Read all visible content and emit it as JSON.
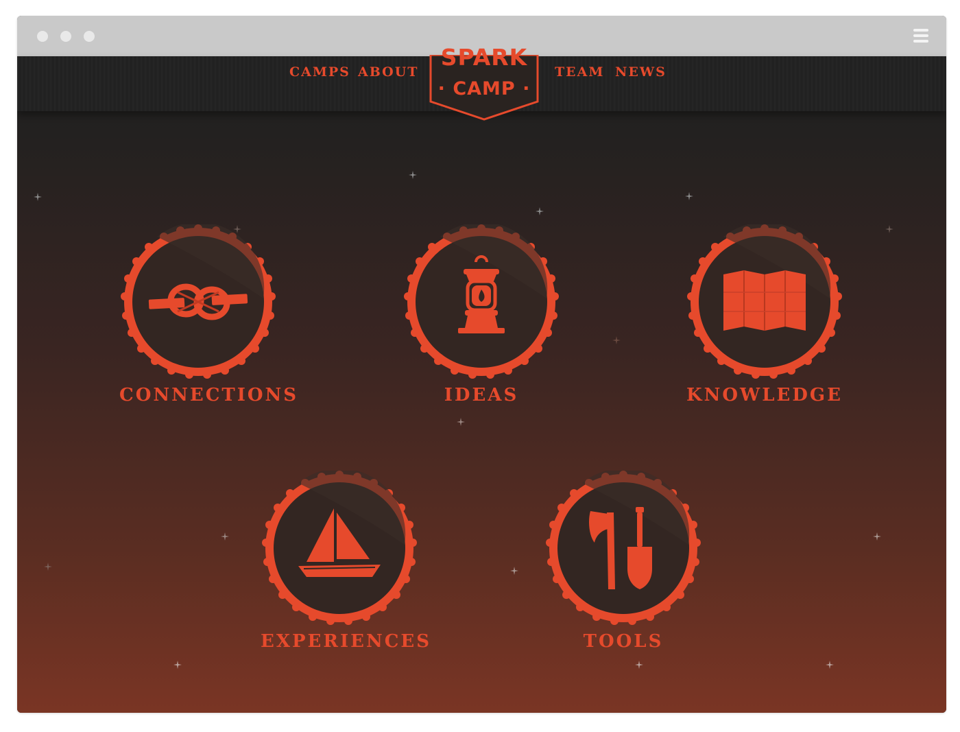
{
  "nav": {
    "camps": "CAMPS",
    "about": "ABOUT",
    "team": "TEAM",
    "news": "NEWS"
  },
  "logo": {
    "line1": "SPARK",
    "line2": "· CAMP ·"
  },
  "badges": {
    "connections": {
      "label": "CONNECTIONS",
      "icon": "knot-icon"
    },
    "ideas": {
      "label": "IDEAS",
      "icon": "lantern-icon"
    },
    "knowledge": {
      "label": "KNOWLEDGE",
      "icon": "map-icon"
    },
    "experiences": {
      "label": "EXPERIENCES",
      "icon": "sailboat-icon"
    },
    "tools": {
      "label": "TOOLS",
      "icon": "axe-shovel-icon"
    }
  },
  "colors": {
    "accent": "#e64a2c",
    "badge_inner": "#332622",
    "nav_bg": "#222222",
    "chrome": "#c9c9c9"
  }
}
